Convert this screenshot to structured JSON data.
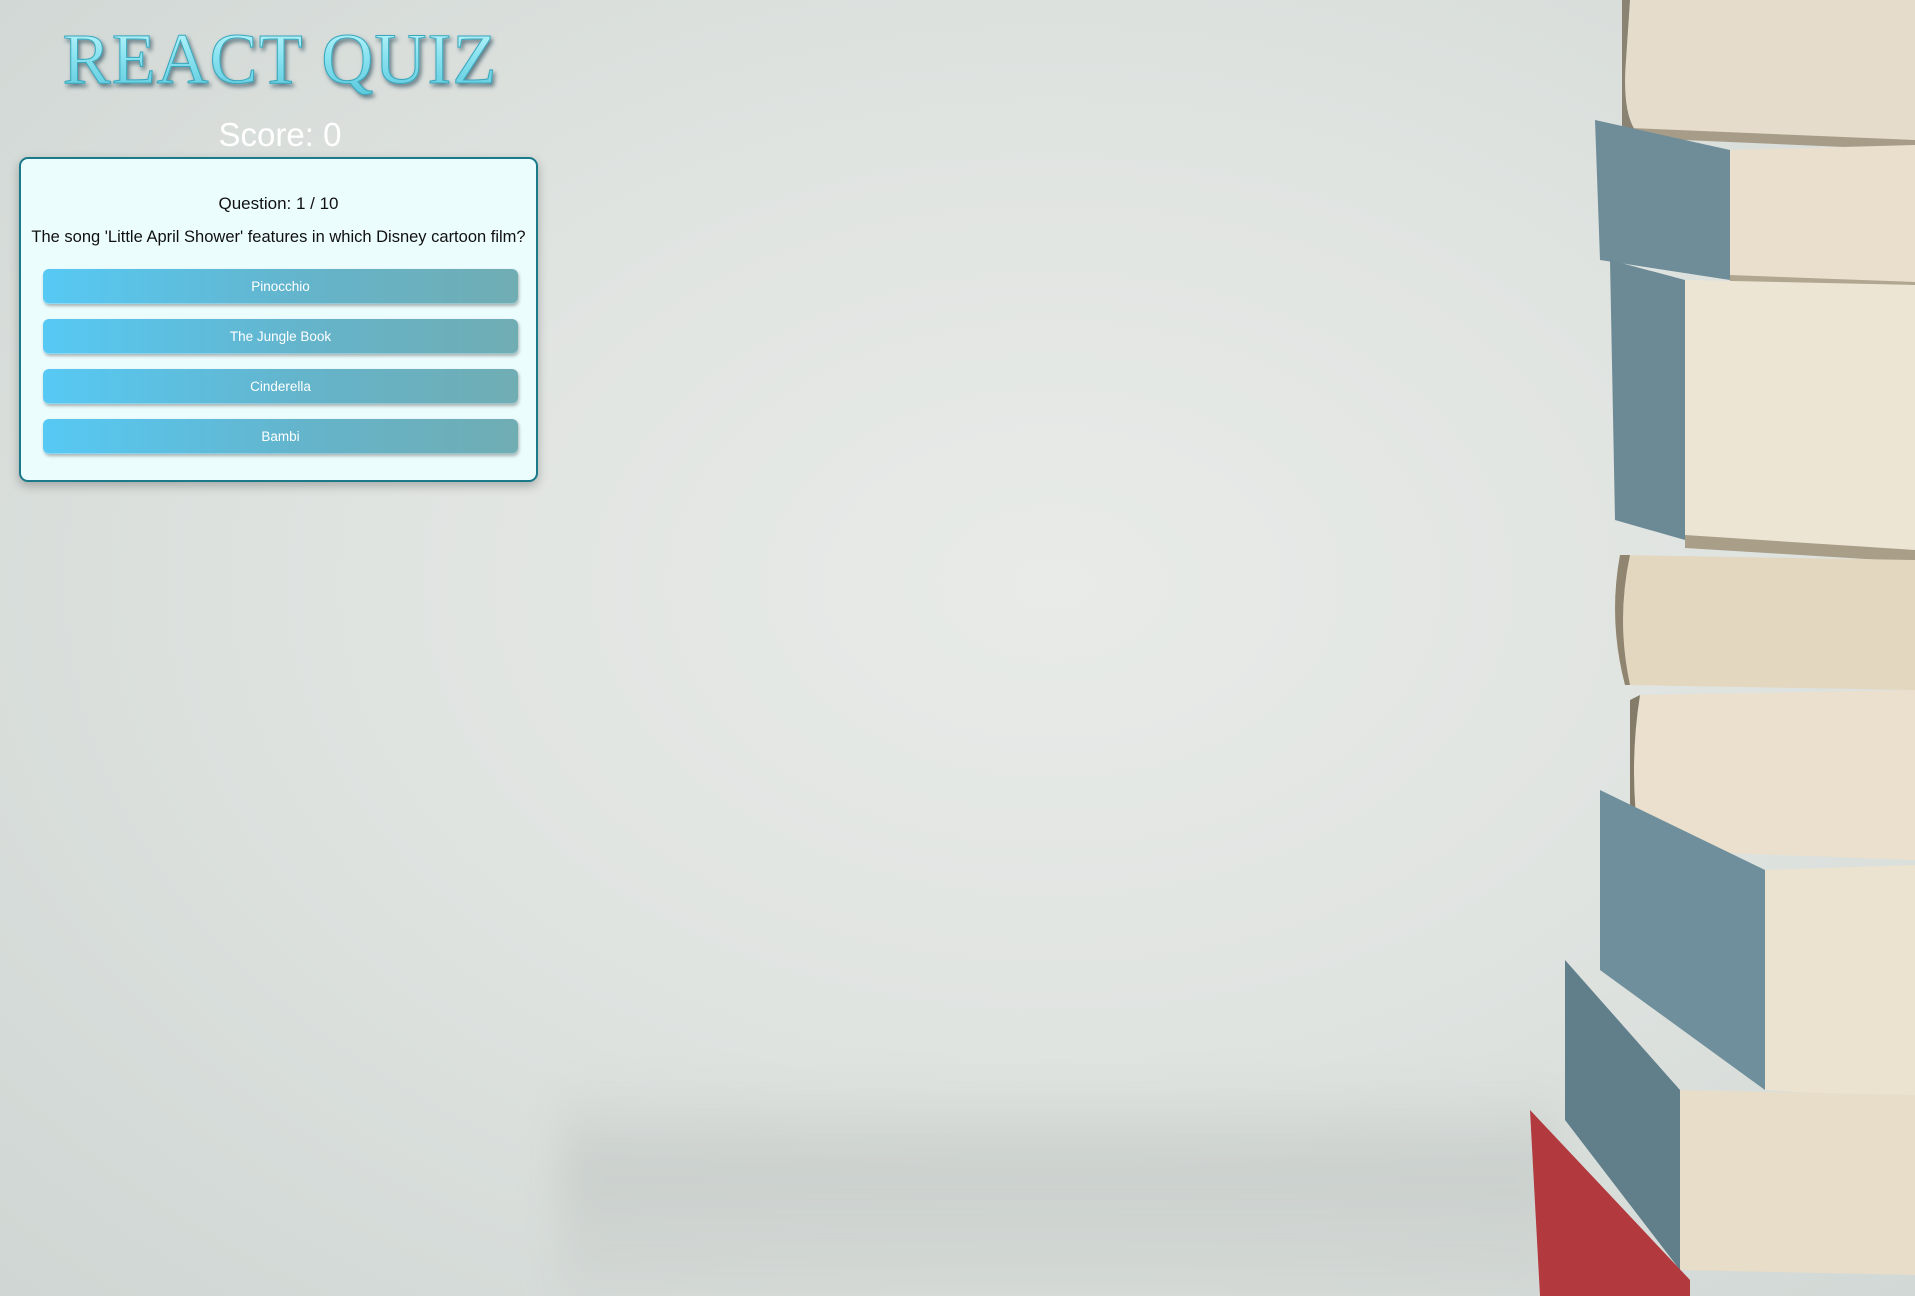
{
  "app": {
    "title": "REACT QUIZ",
    "score_text": "Score: 0"
  },
  "quiz": {
    "question_number": "Question: 1 / 10",
    "question_text": "The song 'Little April Shower' features in which Disney cartoon film?",
    "answers": [
      {
        "label": "Pinocchio"
      },
      {
        "label": "The Jungle Book"
      },
      {
        "label": "Cinderella"
      },
      {
        "label": "Bambi"
      }
    ]
  },
  "colors": {
    "title_gradient_top": "#c9fbff",
    "title_gradient_bottom": "#55c6da",
    "card_background": "#ecfdfe",
    "card_border": "#1a7a8a",
    "button_gradient_start": "#56c9f4",
    "button_gradient_end": "#70adb3"
  }
}
